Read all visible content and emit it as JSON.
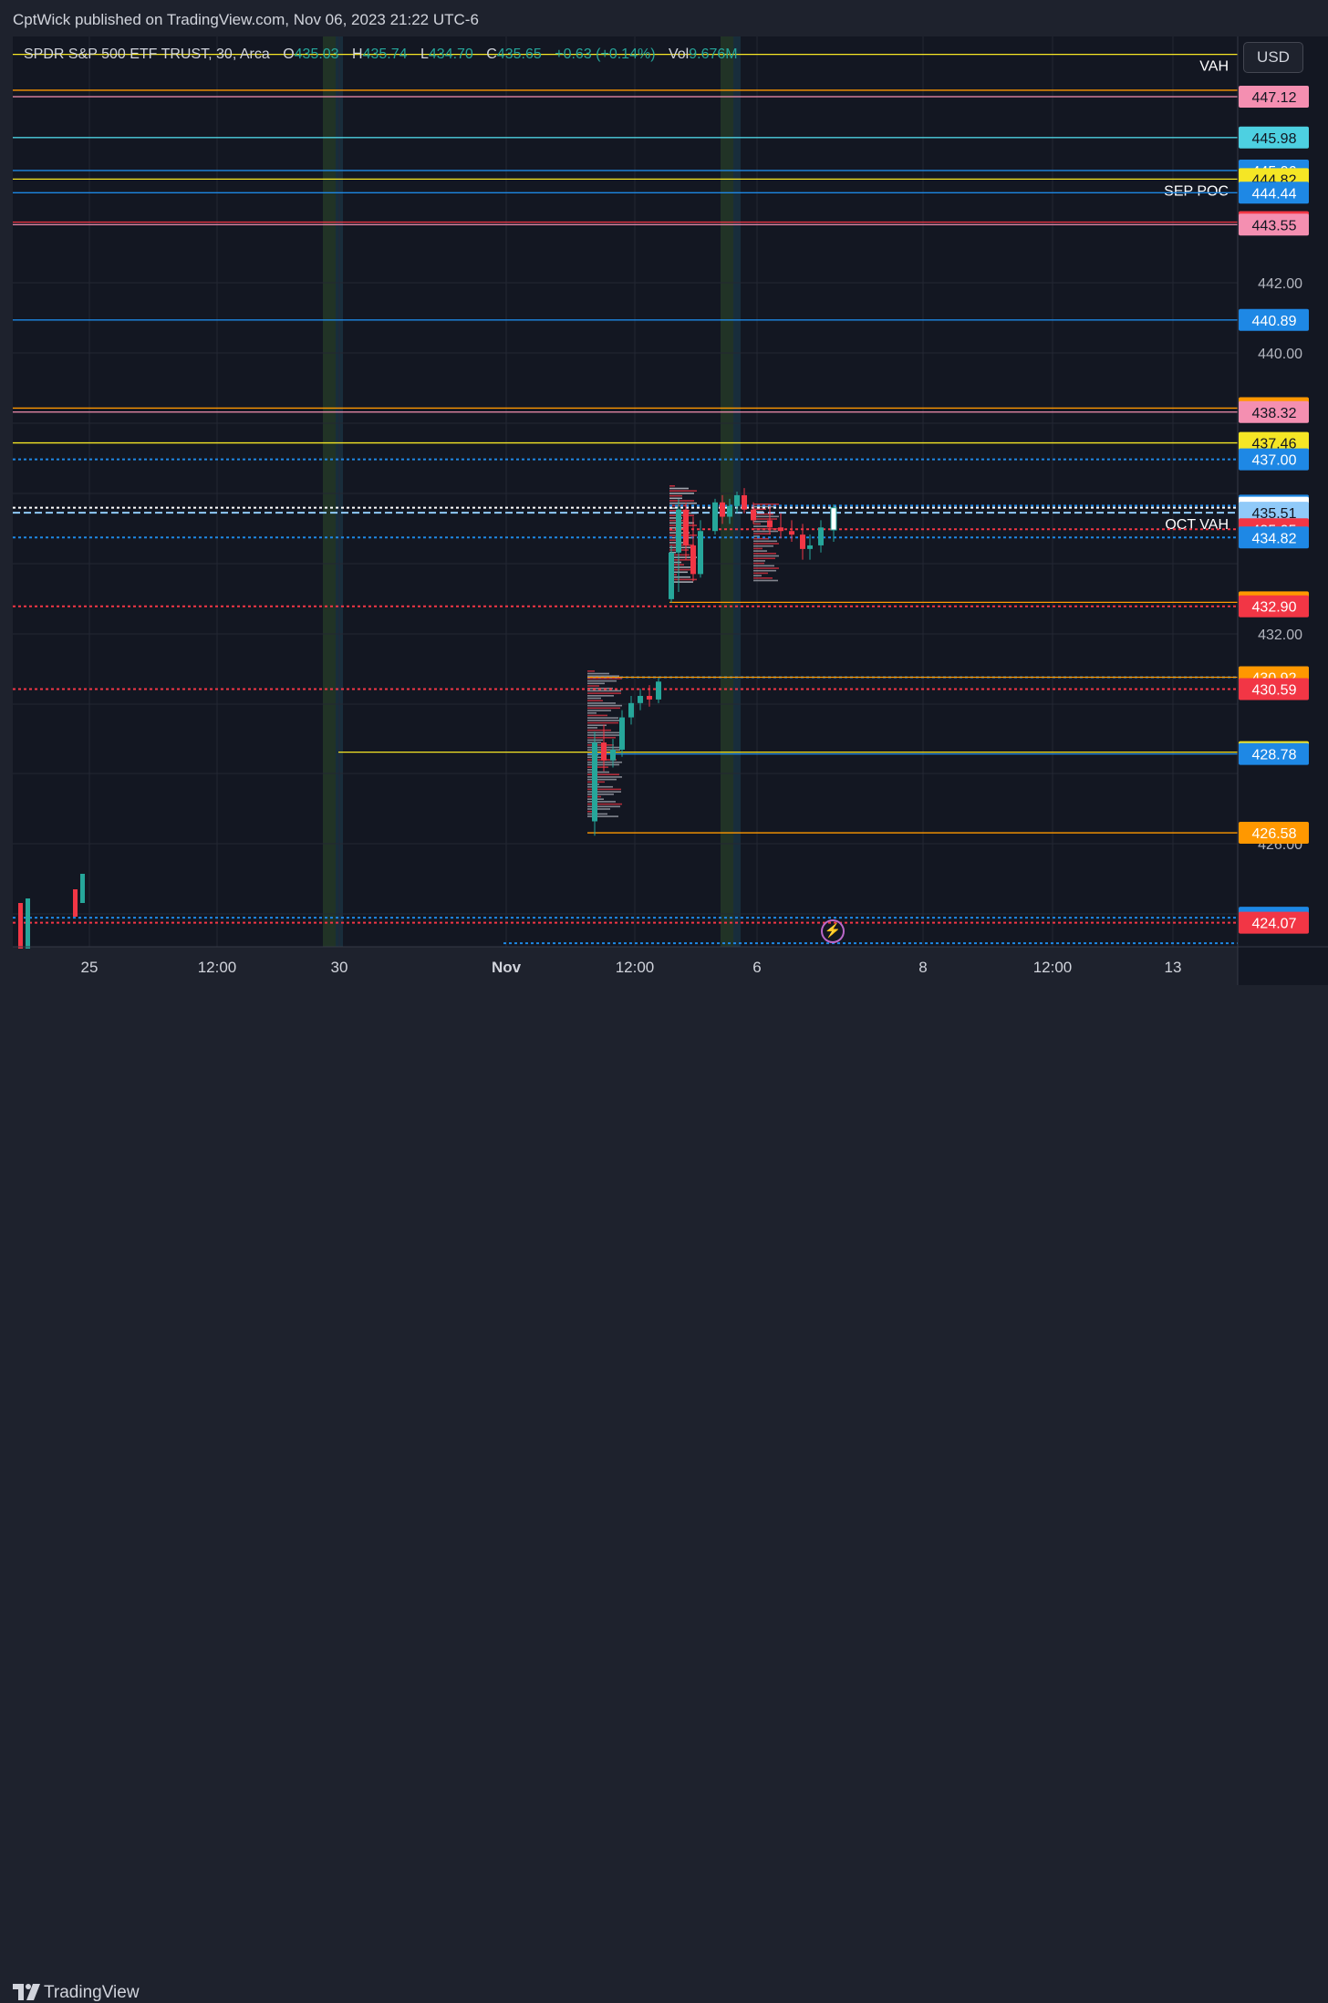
{
  "publisher_line": "CptWick published on TradingView.com, Nov 06, 2023 21:22 UTC-6",
  "legend": {
    "symbol": "SPDR S&P 500 ETF TRUST, 30, Arca",
    "open_label": "O",
    "open": "435.03",
    "high_label": "H",
    "high": "435.74",
    "low_label": "L",
    "low": "434.70",
    "close_label": "C",
    "close": "435.65",
    "change": "+0.63 (+0.14%)",
    "vol_label": "Vol",
    "vol": "9.676M"
  },
  "currency_button": "USD",
  "footer_brand": "TradingView",
  "bolt_icon": "lightning-icon",
  "chart_data": {
    "type": "candlestick",
    "symbol": "SPY",
    "interval": "30",
    "ylim": [
      423.4,
      448.8
    ],
    "price_ticks": [
      "442.00",
      "440.00",
      "432.00",
      "426.00"
    ],
    "time_ticks": [
      "25",
      "12:00",
      "30",
      "Nov",
      "12:00",
      "6",
      "8",
      "12:00",
      "13"
    ],
    "session_bands": [
      "30",
      "6"
    ],
    "levels": [
      {
        "price": 448.3,
        "color": "#f5e625",
        "style": "solid",
        "label": "VAH",
        "tag": ""
      },
      {
        "price": 447.3,
        "color": "#ff9800",
        "style": "solid",
        "label": "",
        "tag": ""
      },
      {
        "price": 447.12,
        "color": "#f48fb1",
        "style": "solid",
        "label": "",
        "tag": "447.12"
      },
      {
        "price": 445.98,
        "color": "#4dd0e1",
        "style": "solid",
        "label": "",
        "tag": "445.98"
      },
      {
        "price": 445.06,
        "color": "#1e88e5",
        "style": "solid",
        "label": "",
        "tag": "445.06"
      },
      {
        "price": 444.82,
        "color": "#f5e625",
        "style": "solid",
        "label": "SEP POC",
        "tag": "444.82"
      },
      {
        "price": 444.44,
        "color": "#1e88e5",
        "style": "solid",
        "label": "",
        "tag": "444.44"
      },
      {
        "price": 443.62,
        "color": "#f23645",
        "style": "solid",
        "label": "",
        "tag": "443.62"
      },
      {
        "price": 443.55,
        "color": "#f48fb1",
        "style": "solid",
        "label": "",
        "tag": "443.55"
      },
      {
        "price": 440.89,
        "color": "#1e88e5",
        "style": "solid",
        "label": "",
        "tag": "440.89"
      },
      {
        "price": 438.43,
        "color": "#ff9800",
        "style": "solid",
        "label": "",
        "tag": "438.43"
      },
      {
        "price": 438.32,
        "color": "#f48fb1",
        "style": "solid",
        "label": "",
        "tag": "438.32"
      },
      {
        "price": 437.46,
        "color": "#f5e625",
        "style": "solid",
        "label": "",
        "tag": "437.46"
      },
      {
        "price": 437.0,
        "color": "#1e88e5",
        "style": "dotted",
        "label": "",
        "tag": "437.00"
      },
      {
        "price": 435.71,
        "color": "#1e88e5",
        "style": "dotted",
        "label": "",
        "tag": "435.71"
      },
      {
        "price": 435.65,
        "color": "#ffffff",
        "style": "dotted",
        "label": "",
        "tag": "435.65"
      },
      {
        "price": 435.51,
        "color": "#90caf9",
        "style": "dashed",
        "label": "OCT VAH",
        "tag": "435.51"
      },
      {
        "price": 435.05,
        "color": "#f23645",
        "style": "dotted",
        "label": "",
        "tag": "435.05"
      },
      {
        "price": 434.82,
        "color": "#1e88e5",
        "style": "dotted",
        "label": "",
        "tag": "434.82"
      },
      {
        "price": 433.01,
        "color": "#ff9800",
        "style": "solid",
        "label": "",
        "tag": "433.01"
      },
      {
        "price": 432.9,
        "color": "#f23645",
        "style": "dotted",
        "label": "",
        "tag": "432.90"
      },
      {
        "price": 430.92,
        "color": "#1e88e5",
        "style": "dotted",
        "label": "",
        "tag": "430.92"
      },
      {
        "price": 430.92,
        "color": "#ff9800",
        "style": "solid",
        "label": "",
        "tag": "430.92"
      },
      {
        "price": 430.59,
        "color": "#f23645",
        "style": "dotted",
        "label": "",
        "tag": "430.59"
      },
      {
        "price": 428.83,
        "color": "#f5e625",
        "style": "solid",
        "label": "",
        "tag": "428.83"
      },
      {
        "price": 428.78,
        "color": "#1e88e5",
        "style": "solid",
        "label": "",
        "tag": "428.78"
      },
      {
        "price": 426.58,
        "color": "#ff9800",
        "style": "solid",
        "label": "",
        "tag": "426.58"
      },
      {
        "price": 424.21,
        "color": "#1e88e5",
        "style": "dotted",
        "label": "",
        "tag": "424.21"
      },
      {
        "price": 424.07,
        "color": "#f23645",
        "style": "dotted",
        "label": "",
        "tag": "424.07"
      },
      {
        "price": 423.5,
        "color": "#1e88e5",
        "style": "dotted",
        "label": "",
        "tag": ""
      }
    ],
    "candles": [
      {
        "o": 426.9,
        "h": 429.4,
        "l": 426.5,
        "c": 429.1
      },
      {
        "o": 429.1,
        "h": 429.6,
        "l": 428.3,
        "c": 428.6
      },
      {
        "o": 428.6,
        "h": 429.2,
        "l": 428.4,
        "c": 428.9
      },
      {
        "o": 428.9,
        "h": 430.0,
        "l": 428.7,
        "c": 429.8
      },
      {
        "o": 429.8,
        "h": 430.4,
        "l": 429.6,
        "c": 430.2
      },
      {
        "o": 430.2,
        "h": 430.6,
        "l": 430.0,
        "c": 430.4
      },
      {
        "o": 430.4,
        "h": 430.7,
        "l": 430.1,
        "c": 430.3
      },
      {
        "o": 430.3,
        "h": 430.9,
        "l": 430.2,
        "c": 430.8
      },
      {
        "o": 433.1,
        "h": 434.6,
        "l": 433.0,
        "c": 434.4
      },
      {
        "o": 434.4,
        "h": 435.9,
        "l": 433.3,
        "c": 435.6
      },
      {
        "o": 435.6,
        "h": 435.8,
        "l": 434.2,
        "c": 434.6
      },
      {
        "o": 434.6,
        "h": 435.4,
        "l": 433.6,
        "c": 433.8
      },
      {
        "o": 433.8,
        "h": 435.3,
        "l": 433.7,
        "c": 435.0
      },
      {
        "o": 435.0,
        "h": 435.9,
        "l": 434.9,
        "c": 435.8
      },
      {
        "o": 435.8,
        "h": 436.0,
        "l": 435.2,
        "c": 435.4
      },
      {
        "o": 435.4,
        "h": 435.9,
        "l": 435.2,
        "c": 435.7
      },
      {
        "o": 435.7,
        "h": 436.1,
        "l": 435.5,
        "c": 436.0
      },
      {
        "o": 436.0,
        "h": 436.2,
        "l": 435.5,
        "c": 435.6
      },
      {
        "o": 435.6,
        "h": 435.8,
        "l": 435.2,
        "c": 435.3
      },
      {
        "o": 435.3,
        "h": 435.7,
        "l": 434.9,
        "c": 435.1
      },
      {
        "o": 435.1,
        "h": 435.5,
        "l": 434.8,
        "c": 435.0
      },
      {
        "o": 435.0,
        "h": 435.3,
        "l": 434.7,
        "c": 434.9
      },
      {
        "o": 434.9,
        "h": 435.2,
        "l": 434.2,
        "c": 434.5
      },
      {
        "o": 434.5,
        "h": 434.9,
        "l": 434.2,
        "c": 434.6
      },
      {
        "o": 434.6,
        "h": 435.3,
        "l": 434.4,
        "c": 435.1
      },
      {
        "o": 435.03,
        "h": 435.74,
        "l": 434.7,
        "c": 435.65
      }
    ]
  }
}
